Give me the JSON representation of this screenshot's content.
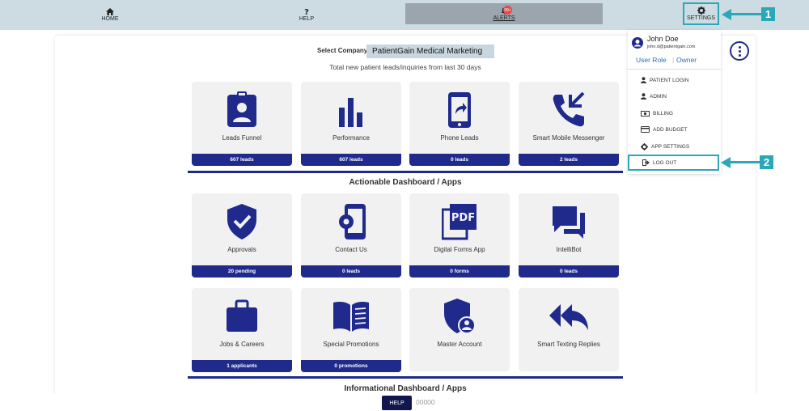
{
  "nav": {
    "home_label": "HOME",
    "help_label": "HELP",
    "alerts_label": "ALERTS",
    "alerts_badge": "99+",
    "settings_label": "SETTINGS",
    "icons": [
      "home-icon",
      "question-icon",
      "bell-icon",
      "gear-icon"
    ]
  },
  "callouts": {
    "one": "1",
    "two": "2"
  },
  "company": {
    "select_label": "Select Company",
    "selected": "PatientGain Medical Marketing"
  },
  "subtitle": "Total new patient leads/inquiries from last 30 days",
  "top_tiles": [
    {
      "label": "Leads Funnel",
      "footer": "607 leads",
      "icon": "id-badge-icon"
    },
    {
      "label": "Performance",
      "footer": "607 leads",
      "icon": "bar-chart-icon"
    },
    {
      "label": "Phone Leads",
      "footer": "0 leads",
      "icon": "phone-share-icon"
    },
    {
      "label": "Smart Mobile Messenger",
      "footer": "2 leads",
      "icon": "phone-call-icon"
    }
  ],
  "actionable": {
    "title": "Actionable Dashboard / Apps",
    "tiles": [
      {
        "label": "Approvals",
        "footer": "20 pending",
        "icon": "shield-check-icon"
      },
      {
        "label": "Contact Us",
        "footer": "0 leads",
        "icon": "mobile-gear-icon"
      },
      {
        "label": "Digital Forms App",
        "footer": "0 forms",
        "icon": "pdf-icon"
      },
      {
        "label": "IntelliBot",
        "footer": "0 leads",
        "icon": "chat-bubbles-icon"
      },
      {
        "label": "Jobs & Careers",
        "footer": "1 applicants",
        "icon": "briefcase-icon"
      },
      {
        "label": "Special Promotions",
        "footer": "0 promotions",
        "icon": "open-book-icon"
      },
      {
        "label": "Master Account",
        "footer": "",
        "icon": "shield-user-icon"
      },
      {
        "label": "Smart Texting Replies",
        "footer": "",
        "icon": "reply-all-icon"
      }
    ]
  },
  "informational": {
    "title": "Informational Dashboard / Apps"
  },
  "user_menu": {
    "name": "John Doe",
    "email": "john.d@patientgain.com",
    "role_label": "User Role",
    "role_value": "Owner",
    "items": [
      {
        "label": "PATIENT LOGIN",
        "icon": "user-icon"
      },
      {
        "label": "ADMIN",
        "icon": "user-icon"
      },
      {
        "label": "BILLING",
        "icon": "money-icon"
      },
      {
        "label": "ADD BUDGET",
        "icon": "credit-card-icon"
      },
      {
        "label": "APP SETTINGS",
        "icon": "gear-icon"
      }
    ],
    "logout_label": "LOG OUT"
  },
  "footer": {
    "help_label": "HELP",
    "counter": "00000"
  },
  "colors": {
    "brand": "#1f2a8c",
    "callout": "#2aa7b8",
    "nav_bg": "#cddbe3"
  }
}
